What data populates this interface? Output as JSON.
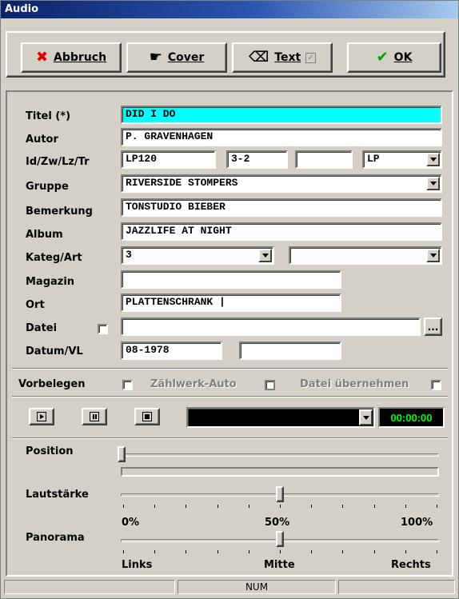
{
  "window": {
    "title": "Audio"
  },
  "toolbar": {
    "cancel_label": "Abbruch",
    "cover_label": "Cover",
    "text_label": "Text",
    "ok_label": "OK"
  },
  "form": {
    "titel_label": "Titel (*)",
    "titel_value": "DID I DO",
    "autor_label": "Autor",
    "autor_value": "P. GRAVENHAGEN",
    "id_label": "Id/Zw/Lz/Tr",
    "id_value": "LP120",
    "zw_value": "3-2",
    "lz_value": "",
    "tr_value": "LP",
    "gruppe_label": "Gruppe",
    "gruppe_value": "RIVERSIDE STOMPERS",
    "bemerkung_label": "Bemerkung",
    "bemerkung_value": "TONSTUDIO BIEBER",
    "album_label": "Album",
    "album_value": "JAZZLIFE AT NIGHT",
    "kateg_label": "Kateg/Art",
    "kateg_value": "3",
    "art_value": "",
    "magazin_label": "Magazin",
    "magazin_value": "",
    "ort_label": "Ort",
    "ort_value": "PLATTENSCHRANK |",
    "datei_label": "Datei",
    "datei_value": "",
    "browse_label": "...",
    "datum_label": "Datum/VL",
    "datum_value": "08-1978",
    "vl_value": ""
  },
  "options": {
    "vorbelegen_label": "Vorbelegen",
    "zaehlwerk_label": "Zählwerk-Auto",
    "datei_uebernehmen_label": "Datei übernehmen"
  },
  "player": {
    "time": "00:00:00",
    "track_value": ""
  },
  "sliders": {
    "position_label": "Position",
    "position_value": 0,
    "lautstaerke_label": "Lautstärke",
    "lautstaerke_value": 50,
    "vol_min": "0%",
    "vol_mid": "50%",
    "vol_max": "100%",
    "panorama_label": "Panorama",
    "panorama_value": 50,
    "pan_left": "Links",
    "pan_mid": "Mitte",
    "pan_right": "Rechts"
  },
  "statusbar": {
    "panel1": "",
    "panel2": "NUM",
    "panel3": ""
  },
  "colors": {
    "title_field_bg": "#00ffff",
    "time_fg": "#00ff00",
    "title_bar": "#0a246a"
  },
  "icons": {
    "cancel": "red-x-icon",
    "cover": "hand-icon",
    "text": "eraser-icon",
    "ok": "green-check-icon"
  }
}
